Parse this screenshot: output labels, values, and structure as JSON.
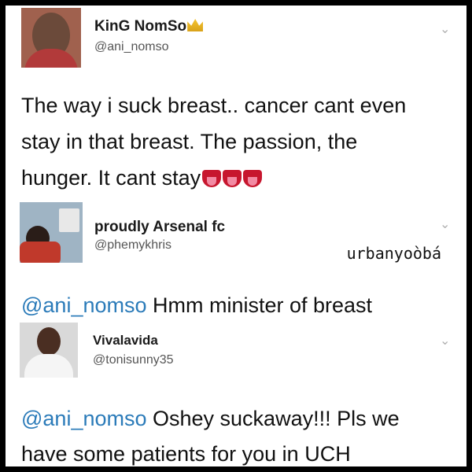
{
  "tweet1": {
    "name": "KinG NomSo",
    "handle": "@ani_nomso",
    "line1": "The way i suck breast.. cancer cant even",
    "line2": "stay in that breast. The passion, the",
    "line3": "hunger. It cant stay",
    "name_emoji": "crown-icon",
    "text_emoji": "tongue-face-icon"
  },
  "tweet2": {
    "name": "proudly Arsenal fc",
    "handle": "@phemykhris",
    "mention": "@ani_nomso",
    "text": " Hmm minister of breast"
  },
  "watermark": "urbanyoòbá",
  "tweet3": {
    "name": "Vivalavida",
    "handle": "@tonisunny35",
    "mention": "@ani_nomso",
    "text": " Oshey suckaway!!! Pls we",
    "line2": "have some patients for you in UCH"
  },
  "colors": {
    "mention": "#2b7bb9",
    "frame": "#000000"
  }
}
